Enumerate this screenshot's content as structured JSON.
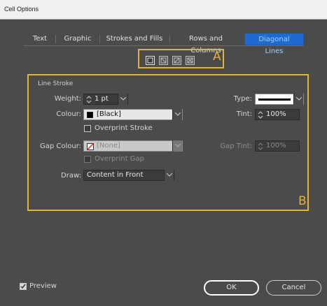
{
  "window": {
    "title": "Cell Options"
  },
  "tabs": [
    {
      "label": "Text"
    },
    {
      "label": "Graphic"
    },
    {
      "label": "Strokes and Fills"
    },
    {
      "label": "Rows and Columns"
    },
    {
      "label": "Diagonal Lines"
    }
  ],
  "active_tab": "Diagonal Lines",
  "annotations": {
    "a": "A",
    "b": "B"
  },
  "diagonal_icons": [
    "no-diagonal-icon",
    "top-left-to-bottom-right-icon",
    "bottom-left-to-top-right-icon",
    "cross-diagonal-icon"
  ],
  "line_stroke": {
    "title": "Line Stroke",
    "weight_label": "Weight:",
    "weight_value": "1 pt",
    "type_label": "Type:",
    "colour_label": "Colour:",
    "colour_value": "[Black]",
    "tint_label": "Tint:",
    "tint_value": "100%",
    "overprint_stroke_label": "Overprint Stroke",
    "gap_colour_label": "Gap Colour:",
    "gap_colour_value": "[None]",
    "gap_tint_label": "Gap Tint:",
    "gap_tint_value": "100%",
    "overprint_gap_label": "Overprint Gap",
    "draw_label": "Draw:",
    "draw_value": "Content in Front"
  },
  "footer": {
    "preview_label": "Preview",
    "ok_label": "OK",
    "cancel_label": "Cancel"
  },
  "colors": {
    "accent": "#1f6ad1",
    "annotation": "#e3b43b",
    "background": "#4b4b4b"
  }
}
